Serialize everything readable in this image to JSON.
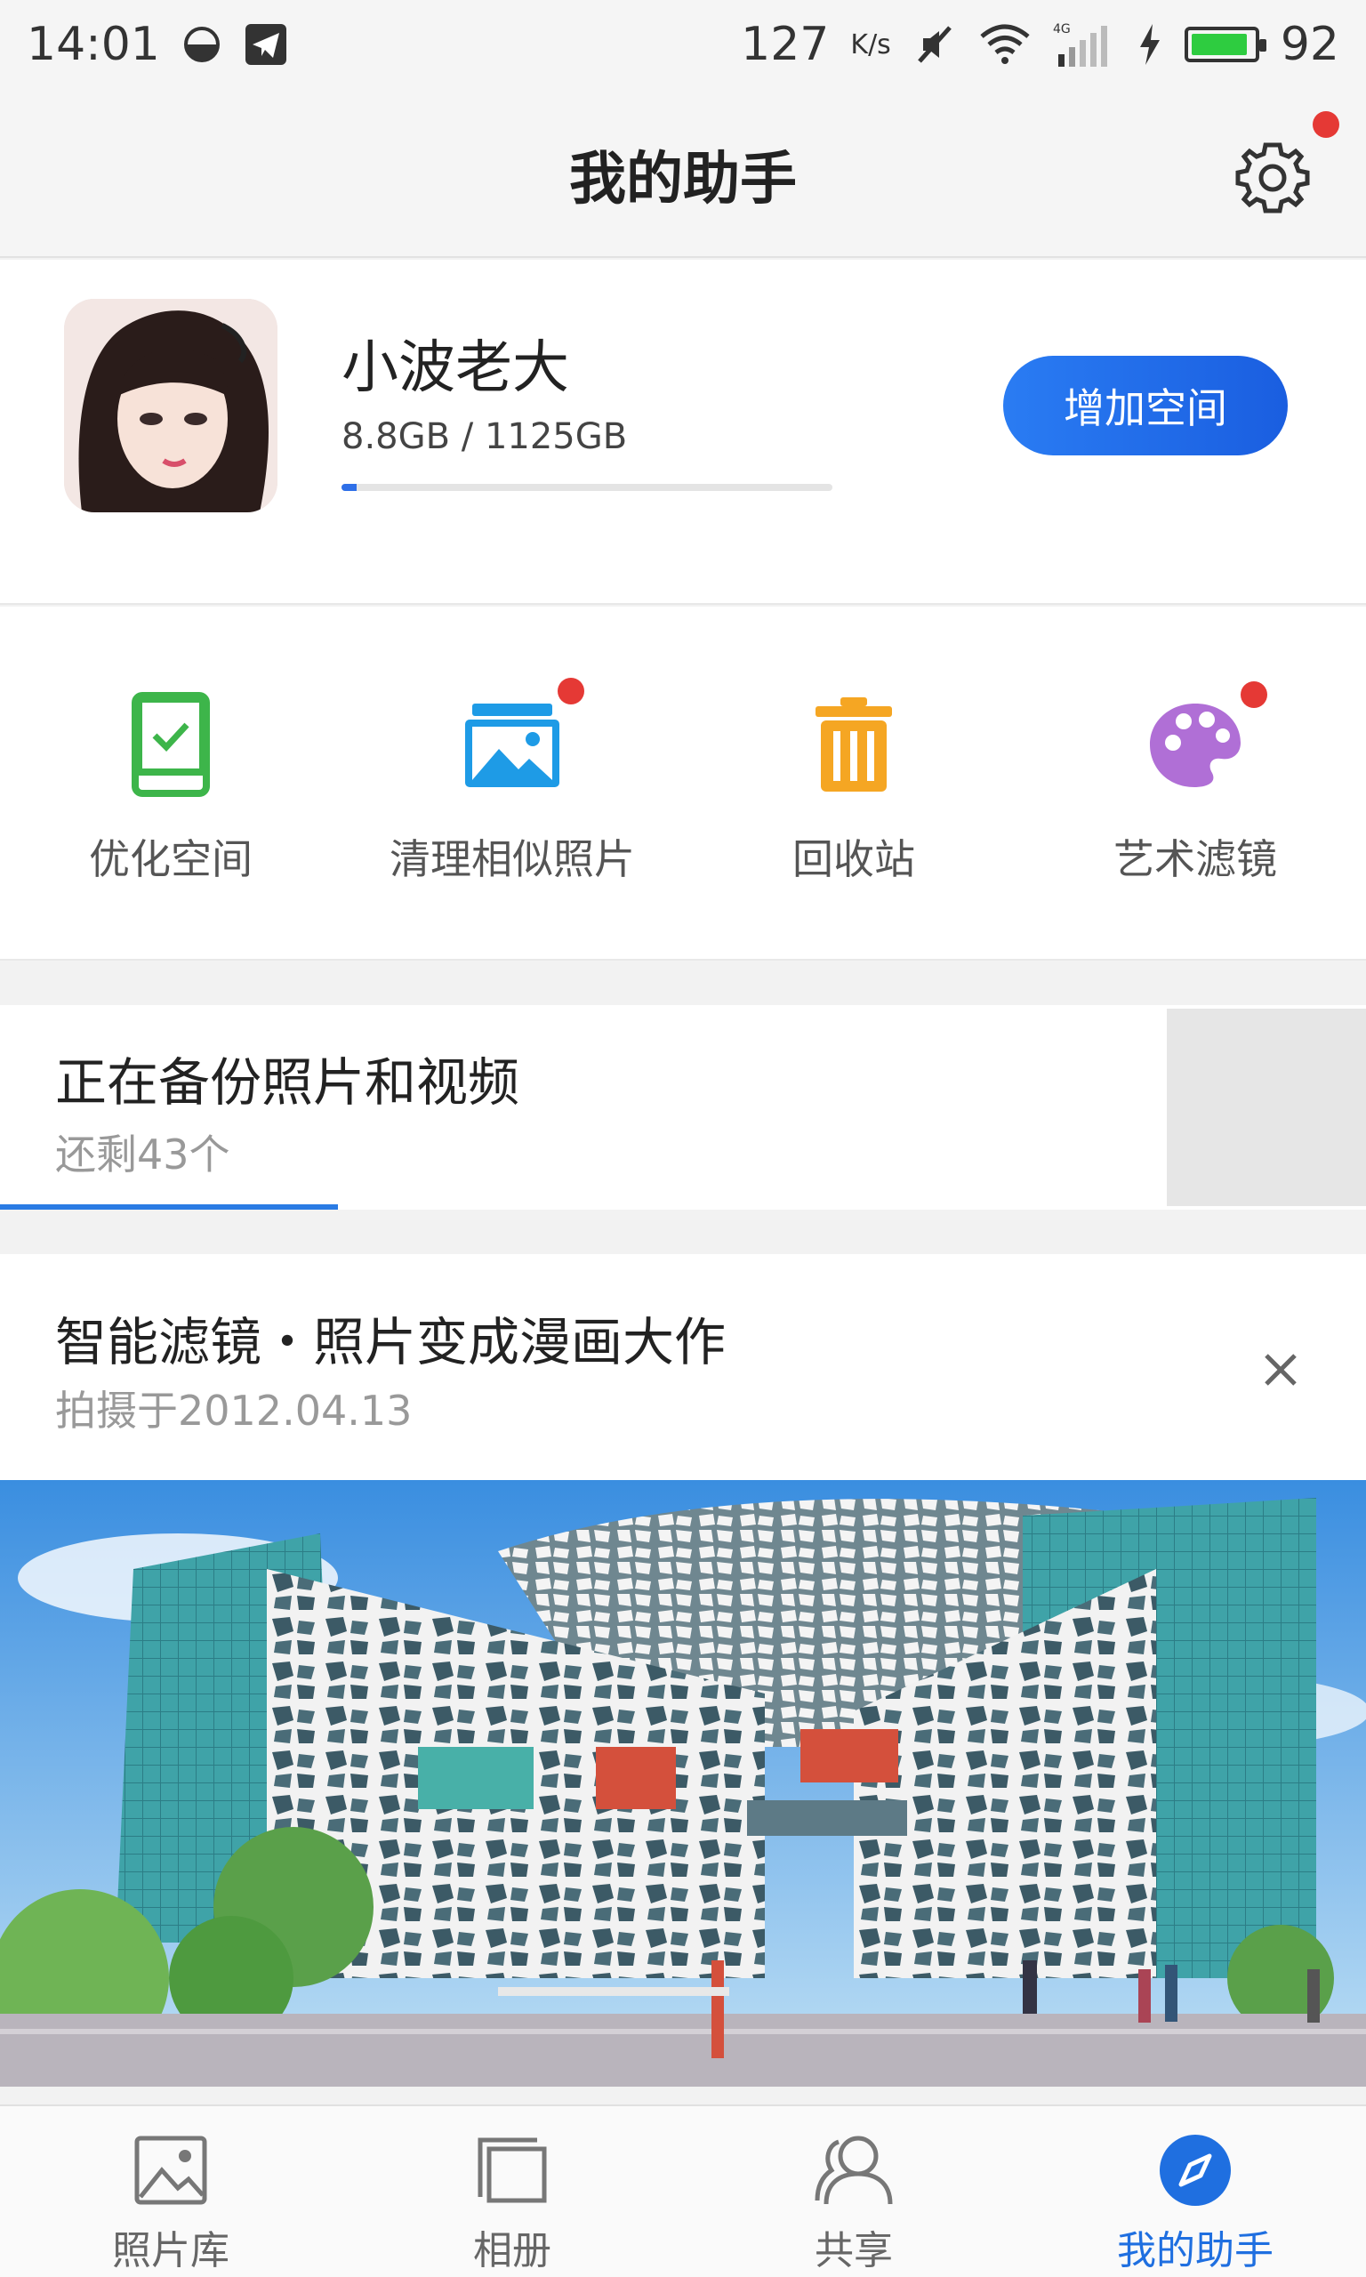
{
  "status_bar": {
    "time": "14:01",
    "net_speed": "127",
    "net_unit": "K/s",
    "network_type": "4G",
    "battery": "92",
    "battery_level": 0.92
  },
  "header": {
    "title": "我的助手",
    "settings_icon": "gear-icon",
    "has_notification": true
  },
  "profile": {
    "name": "小波老大",
    "storage": "8.8GB / 1125GB",
    "storage_used_fraction": 0.0078,
    "add_space_label": "增加空间"
  },
  "tools": [
    {
      "label": "优化空间",
      "icon": "phone-check-icon",
      "color": "#3db54a",
      "badge": false
    },
    {
      "label": "清理相似照片",
      "icon": "photos-icon",
      "color": "#1e9be6",
      "badge": true
    },
    {
      "label": "回收站",
      "icon": "trash-icon",
      "color": "#f5a623",
      "badge": false
    },
    {
      "label": "艺术滤镜",
      "icon": "palette-icon",
      "color": "#b06fd6",
      "badge": true
    }
  ],
  "backup": {
    "title": "正在备份照片和视频",
    "remaining": "还剩43个",
    "progress_fraction": 0.29
  },
  "feature": {
    "title": "智能滤镜・照片变成漫画大作",
    "date": "拍摄于2012.04.13",
    "close_icon": "close-icon"
  },
  "bottom_nav": [
    {
      "label": "照片库",
      "icon": "gallery-icon",
      "active": false
    },
    {
      "label": "相册",
      "icon": "album-icon",
      "active": false
    },
    {
      "label": "共享",
      "icon": "share-people-icon",
      "active": false
    },
    {
      "label": "我的助手",
      "icon": "compass-icon",
      "active": true
    }
  ],
  "colors": {
    "accent": "#1f6fe0",
    "badge": "#e53935"
  }
}
